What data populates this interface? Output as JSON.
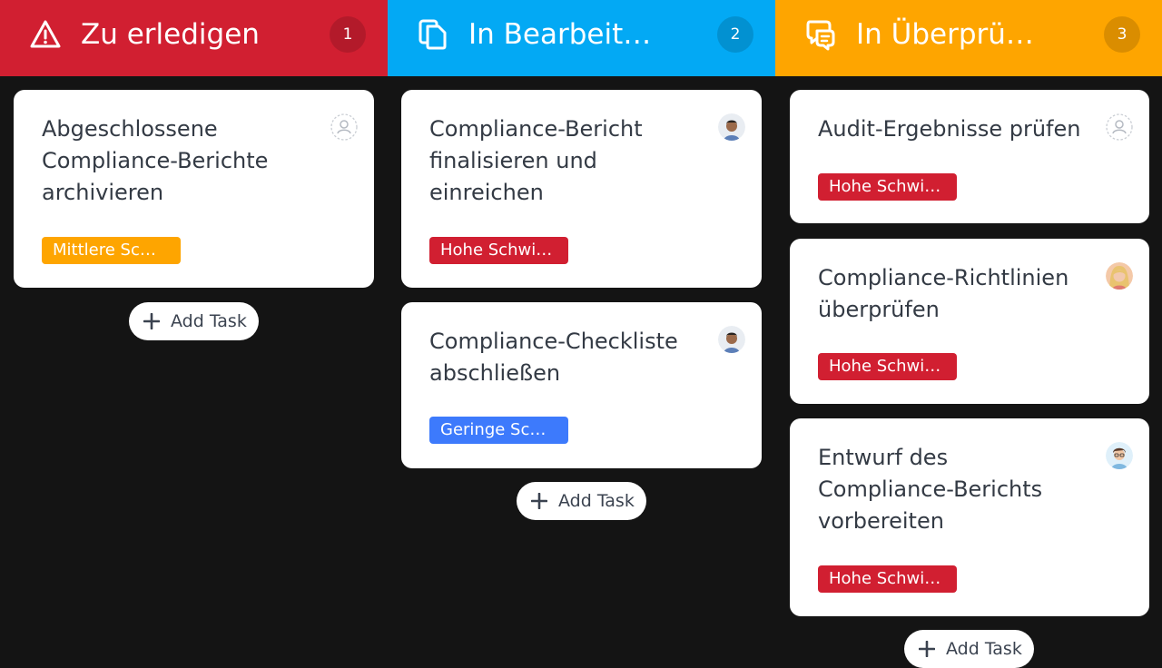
{
  "columns": [
    {
      "title": "Zu erledigen",
      "count": "1",
      "color": "#d11f31",
      "icon": "warning-icon",
      "cards": [
        {
          "title": "Abgeschlossene Compliance-Berichte archivieren",
          "tag": "Mittlere Sc…",
          "tag_color": "#fea500",
          "assignee": "unassigned-icon"
        }
      ],
      "add_label": "Add Task"
    },
    {
      "title": "In Bearbeit…",
      "count": "2",
      "color": "#03a9f4",
      "icon": "copy-icon",
      "cards": [
        {
          "title": "Compliance-Bericht finalisieren und einreichen",
          "tag": "Hohe Schwi…",
          "tag_color": "#d11f31",
          "assignee": "avatar-man"
        },
        {
          "title": "Compliance-Checkliste abschließen",
          "tag": "Geringe Sc…",
          "tag_color": "#3d7afc",
          "assignee": "avatar-man"
        }
      ],
      "add_label": "Add Task"
    },
    {
      "title": "In Überprü…",
      "count": "3",
      "color": "#fea500",
      "icon": "review-chat-icon",
      "cards": [
        {
          "title": "Audit-Ergebnisse prüfen",
          "tag": "Hohe Schwi…",
          "tag_color": "#d11f31",
          "assignee": "unassigned-icon"
        },
        {
          "title": "Compliance-Richtlinien überprüfen",
          "tag": "Hohe Schwi…",
          "tag_color": "#d11f31",
          "assignee": "avatar-woman"
        },
        {
          "title": "Entwurf des Compliance-Berichts vorbereiten",
          "tag": "Hohe Schwi…",
          "tag_color": "#d11f31",
          "assignee": "avatar-boy"
        }
      ],
      "add_label": "Add Task"
    }
  ]
}
